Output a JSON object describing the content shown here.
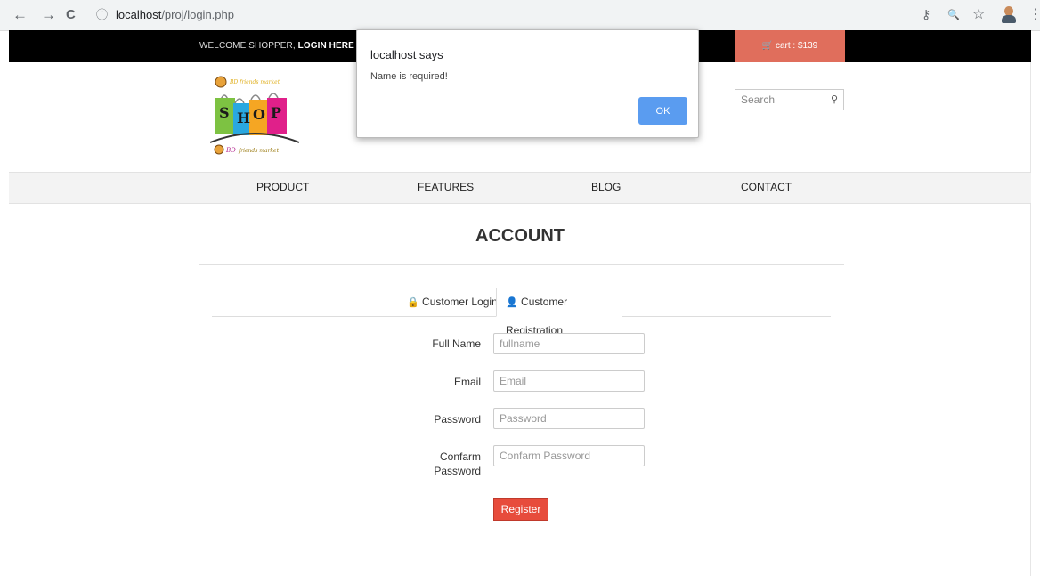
{
  "browser": {
    "back_icon": "←",
    "forward_icon": "→",
    "reload_icon": "C",
    "info_icon": "ⓘ",
    "url_host": "localhost",
    "url_path": "/proj/login.php",
    "key_icon": "⚷",
    "zoom_icon": "🔍",
    "star_icon": "☆",
    "menu_icon": "⋮"
  },
  "topbar": {
    "welcome_text": "WELCOME SHOPPER, ",
    "login_link": "LOGIN HERE",
    "cart_label": "cart : $139"
  },
  "logo": {
    "text": "SHOP",
    "tagline": "BD Friends market"
  },
  "search": {
    "placeholder": "Search"
  },
  "nav": {
    "items": [
      "PRODUCT",
      "FEATURES",
      "BLOG",
      "CONTACT"
    ]
  },
  "page": {
    "title": "ACCOUNT"
  },
  "tabs": {
    "login": "Customer Login",
    "registration": "Customer Registration"
  },
  "form": {
    "fullname_label": "Full Name",
    "fullname_placeholder": "fullname",
    "email_label": "Email",
    "email_placeholder": "Email",
    "password_label": "Password",
    "password_placeholder": "Password",
    "confirm_label_line1": "Confarm",
    "confirm_label_line2": "Password",
    "confirm_placeholder": "Confarm Password",
    "register_label": "Register"
  },
  "dialog": {
    "title": "localhost says",
    "message": "Name is required!",
    "ok_label": "OK"
  }
}
